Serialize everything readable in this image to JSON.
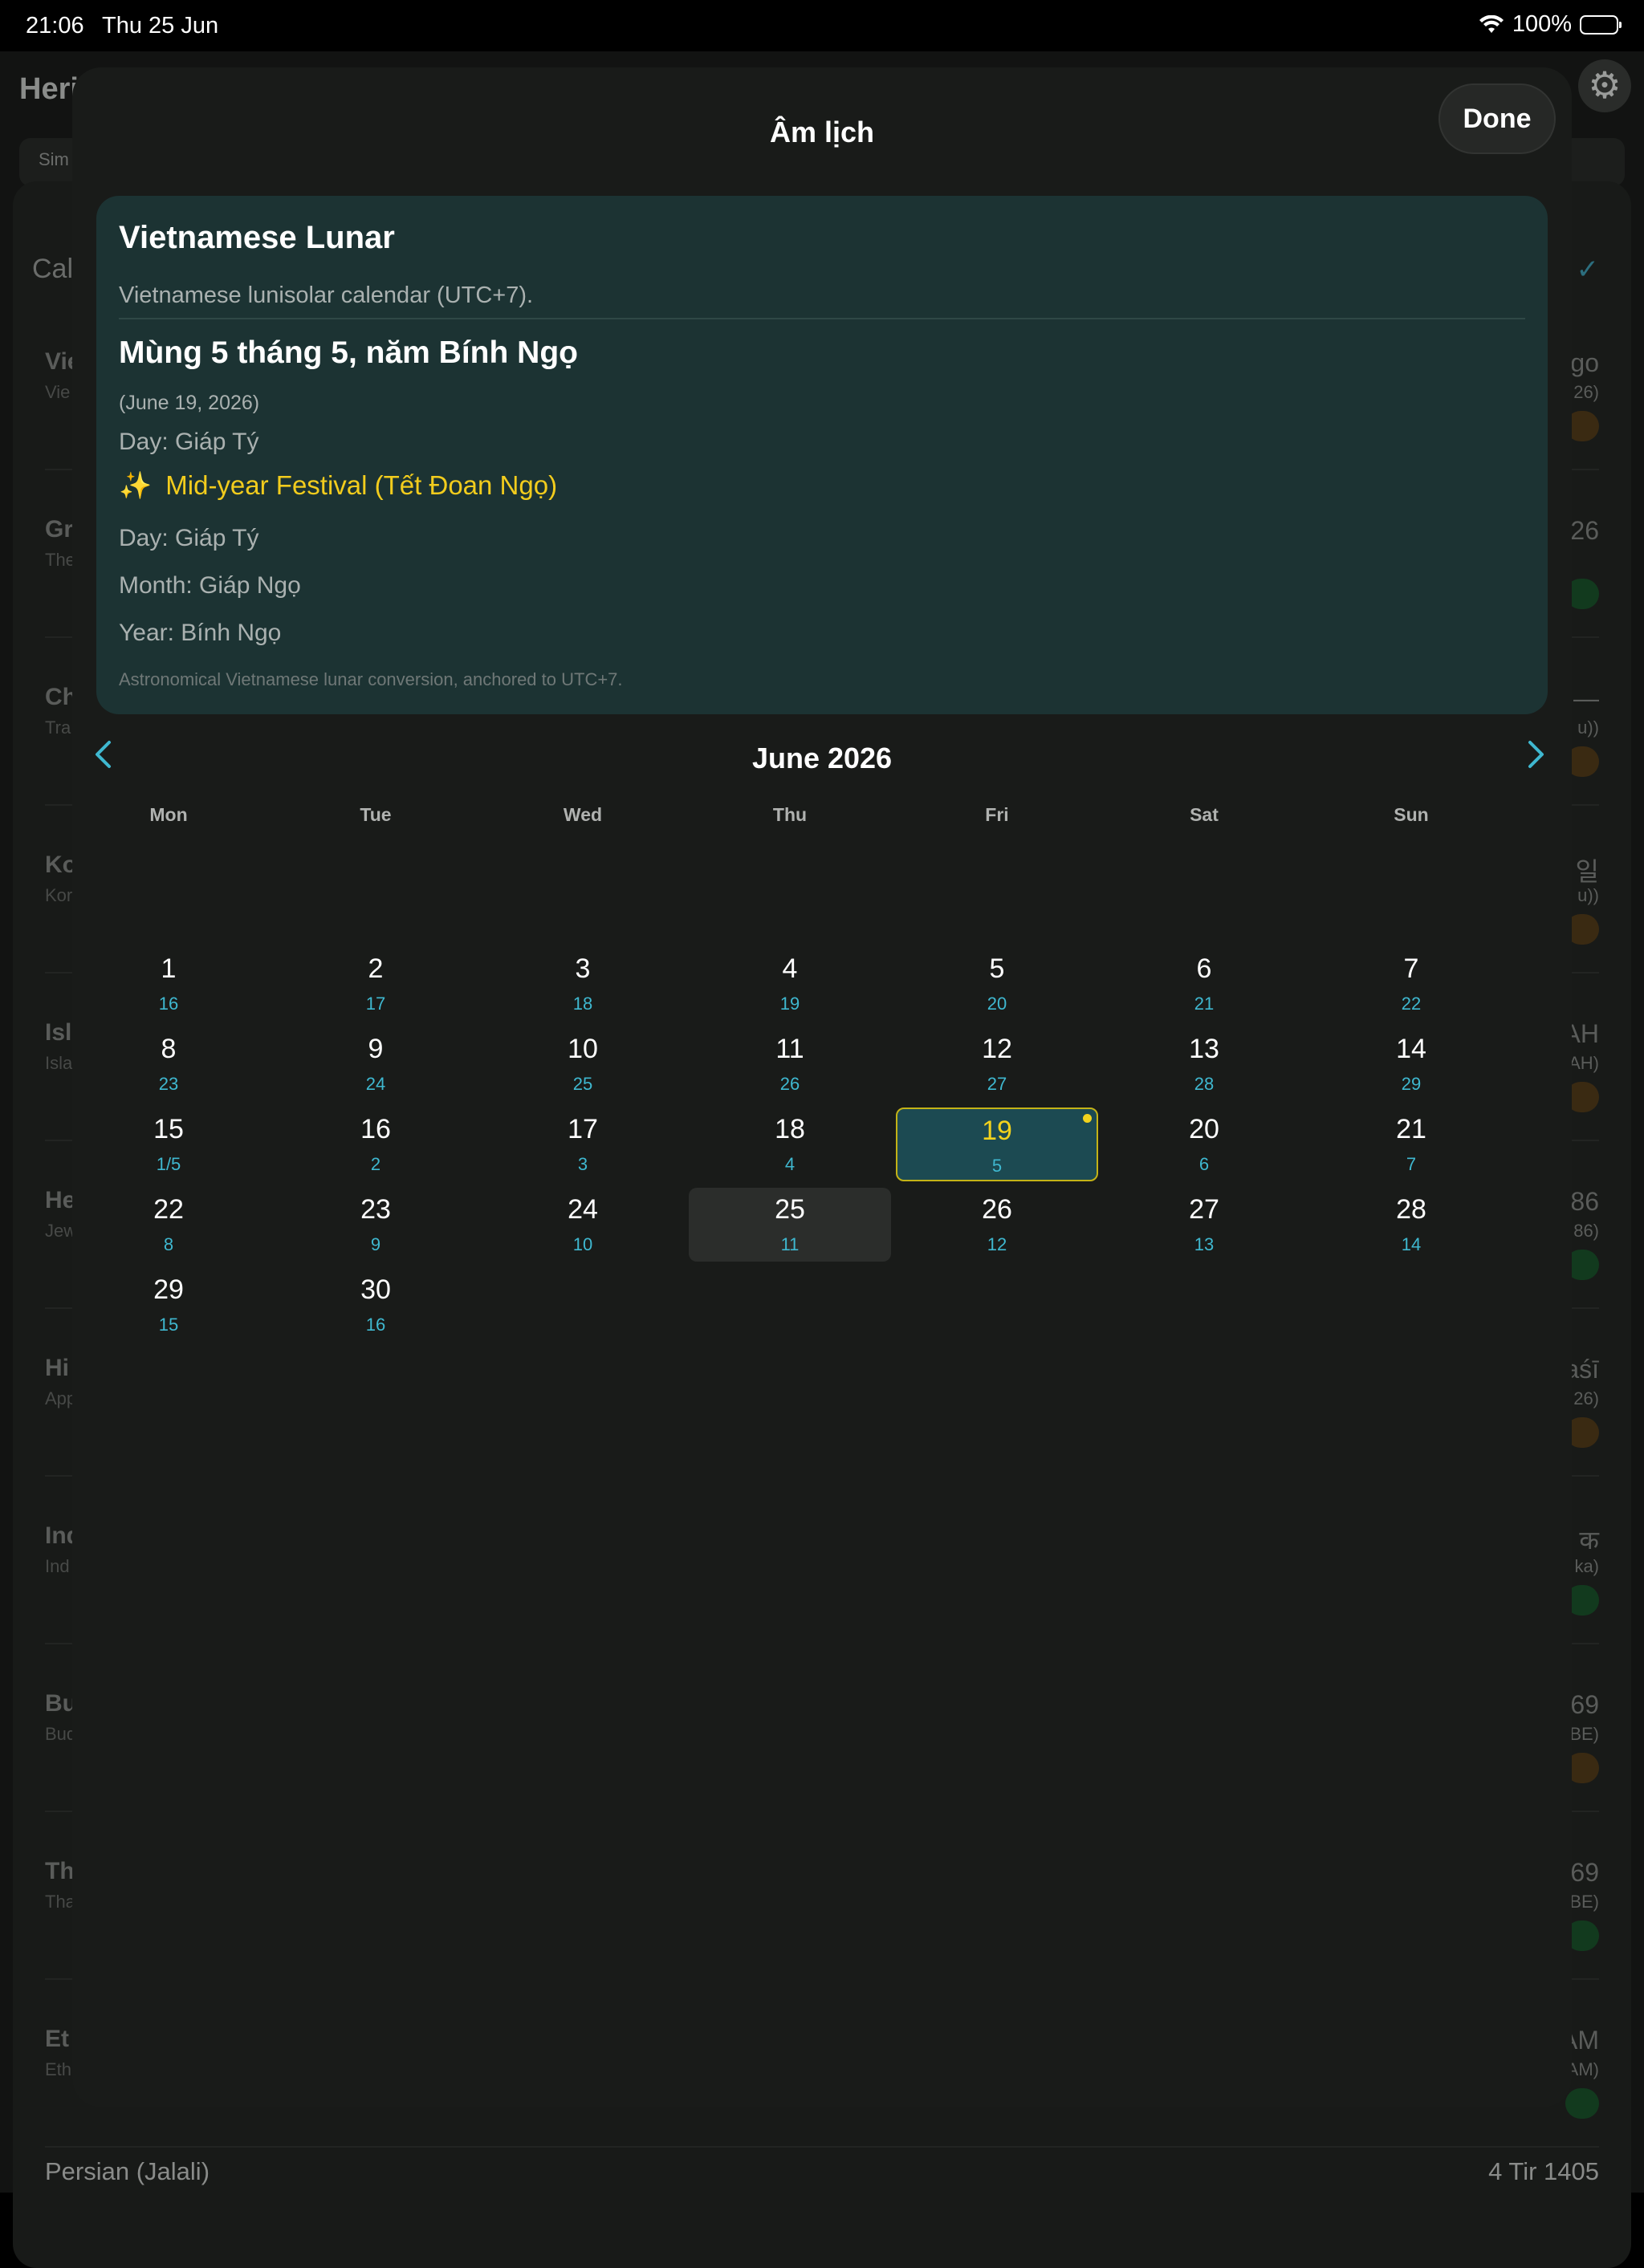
{
  "status_bar": {
    "time": "21:06",
    "date": "Thu 25 Jun",
    "battery": "100%"
  },
  "background": {
    "title": "Heri",
    "segment_label": "Sim",
    "section_label": "Cal",
    "rows": [
      {
        "left": "Vie",
        "sub": "Vie",
        "right": "go",
        "right_sub": "26)",
        "pill": "orange"
      },
      {
        "left": "Gr",
        "sub": "The",
        "right": "26",
        "right_sub": "",
        "pill": "green"
      },
      {
        "left": "Ch",
        "sub": "Tra",
        "right": "—",
        "right_sub": "u))",
        "pill": "orange"
      },
      {
        "left": "Ko",
        "sub": "Kor",
        "right": "일",
        "right_sub": "u))",
        "pill": "orange"
      },
      {
        "left": "Isl",
        "sub": "Isla",
        "right": "AH",
        "right_sub": "AH)",
        "pill": "orange"
      },
      {
        "left": "He",
        "sub": "Jew",
        "right": "86",
        "right_sub": "86)",
        "pill": "green"
      },
      {
        "left": "Hi",
        "sub": "App",
        "right": "aśī",
        "right_sub": "26)",
        "pill": "orange"
      },
      {
        "left": "Ind",
        "sub": "Ind",
        "right": "क",
        "right_sub": "ka)",
        "pill": "green"
      },
      {
        "left": "Bu",
        "sub": "Bud",
        "right": "69",
        "right_sub": "BE)",
        "pill": "orange"
      },
      {
        "left": "Th",
        "sub": "Tha",
        "right": "69",
        "right_sub": "BE)",
        "pill": "green"
      },
      {
        "left": "Et",
        "sub": "Eth",
        "right": "AM",
        "right_sub": "AM)",
        "pill": "green"
      }
    ],
    "bottom_left": "Persian (Jalali)",
    "bottom_right": "4 Tir 1405"
  },
  "sheet": {
    "title": "Âm lịch",
    "done_label": "Done"
  },
  "info": {
    "calendar_name": "Vietnamese Lunar",
    "description": "Vietnamese lunisolar calendar (UTC+7).",
    "lunar_date": "Mùng 5 tháng 5, năm Bính Ngọ",
    "gregorian_date": "(June 19, 2026)",
    "day_line": "Day: Giáp Tý",
    "festival_icon": "✨",
    "festival": "Mid-year Festival (Tết Đoan Ngọ)",
    "day_line2": "Day: Giáp Tý",
    "month_line": "Month: Giáp Ngọ",
    "year_line": "Year: Bính Ngọ",
    "note": "Astronomical Vietnamese lunar conversion, anchored to UTC+7."
  },
  "calendar": {
    "month_title": "June 2026",
    "weekdays": [
      "Mon",
      "Tue",
      "Wed",
      "Thu",
      "Fri",
      "Sat",
      "Sun"
    ],
    "weeks": [
      [
        {
          "d": "1",
          "l": "16"
        },
        {
          "d": "2",
          "l": "17"
        },
        {
          "d": "3",
          "l": "18"
        },
        {
          "d": "4",
          "l": "19"
        },
        {
          "d": "5",
          "l": "20"
        },
        {
          "d": "6",
          "l": "21"
        },
        {
          "d": "7",
          "l": "22"
        }
      ],
      [
        {
          "d": "8",
          "l": "23"
        },
        {
          "d": "9",
          "l": "24"
        },
        {
          "d": "10",
          "l": "25"
        },
        {
          "d": "11",
          "l": "26"
        },
        {
          "d": "12",
          "l": "27"
        },
        {
          "d": "13",
          "l": "28"
        },
        {
          "d": "14",
          "l": "29"
        }
      ],
      [
        {
          "d": "15",
          "l": "1/5"
        },
        {
          "d": "16",
          "l": "2"
        },
        {
          "d": "17",
          "l": "3"
        },
        {
          "d": "18",
          "l": "4"
        },
        {
          "d": "19",
          "l": "5",
          "selected": true,
          "event": true
        },
        {
          "d": "20",
          "l": "6"
        },
        {
          "d": "21",
          "l": "7"
        }
      ],
      [
        {
          "d": "22",
          "l": "8"
        },
        {
          "d": "23",
          "l": "9"
        },
        {
          "d": "24",
          "l": "10"
        },
        {
          "d": "25",
          "l": "11",
          "today": true
        },
        {
          "d": "26",
          "l": "12"
        },
        {
          "d": "27",
          "l": "13"
        },
        {
          "d": "28",
          "l": "14"
        }
      ],
      [
        {
          "d": "29",
          "l": "15"
        },
        {
          "d": "30",
          "l": "16"
        }
      ]
    ]
  },
  "colors": {
    "accent": "#3fb8d0",
    "festival": "#f2cc1d",
    "info_bg": "#1c3333"
  }
}
